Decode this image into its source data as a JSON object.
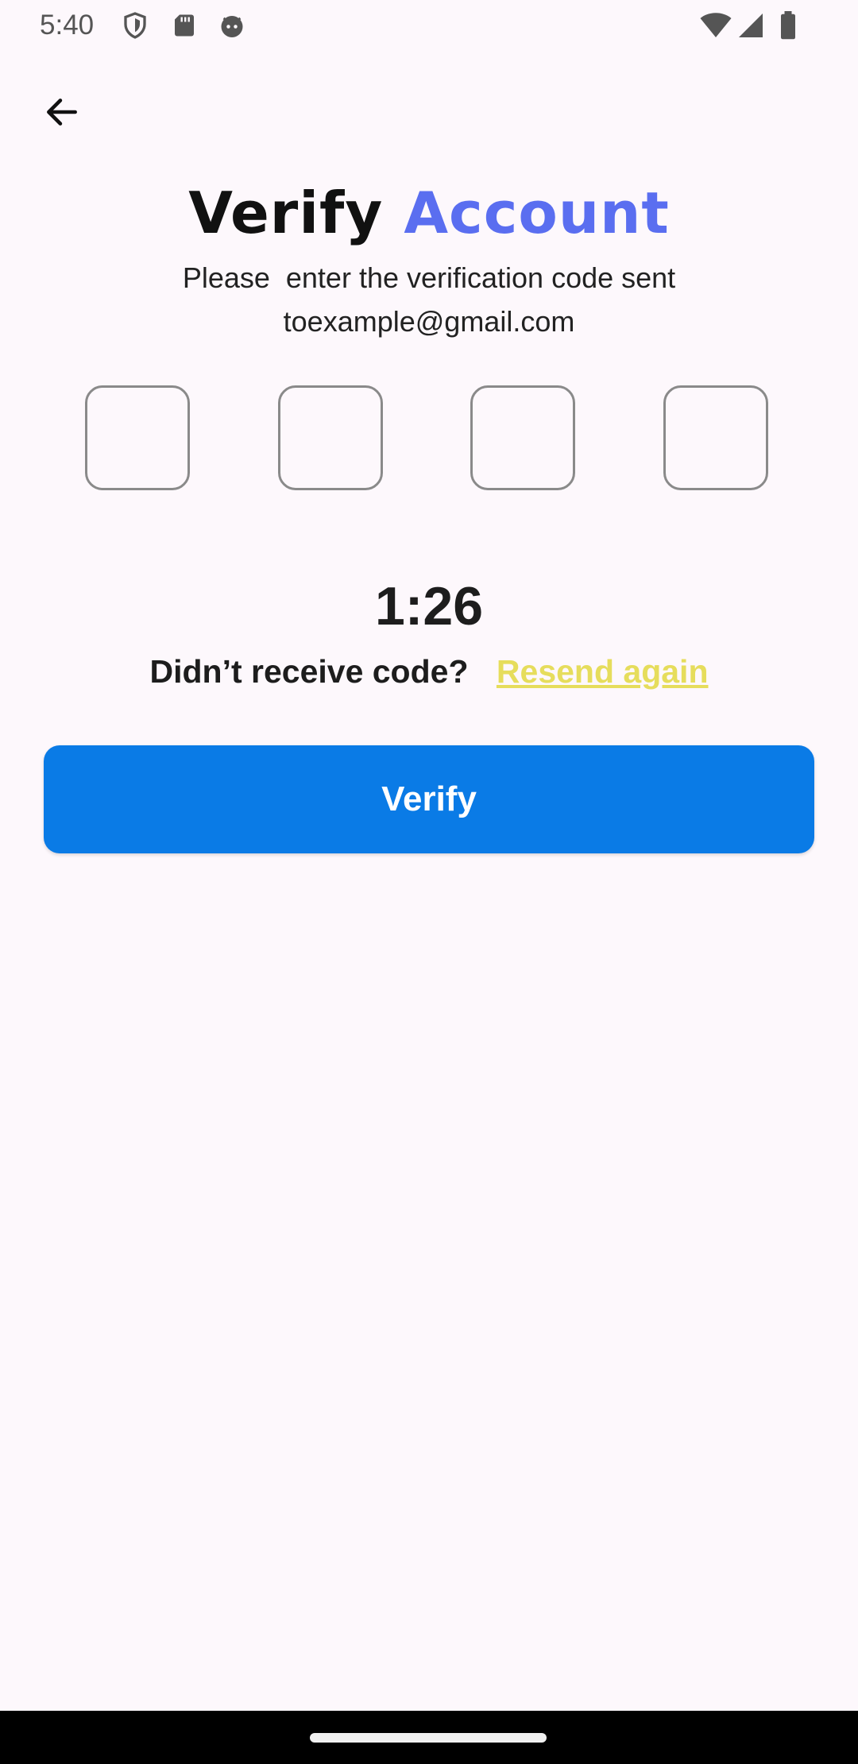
{
  "status_bar": {
    "time": "5:40",
    "icons": [
      "shield-icon",
      "sd-card-icon",
      "android-face-icon",
      "wifi-icon",
      "signal-icon",
      "battery-icon"
    ]
  },
  "header": {
    "back_icon": "arrow-left-icon"
  },
  "title": {
    "part1": "Verify",
    "part2": "Account",
    "accent_color": "#5a6ef0"
  },
  "subtitle": {
    "line1": "Please  enter the verification code sent",
    "line2": "toexample@gmail.com"
  },
  "code_inputs": [
    {
      "value": ""
    },
    {
      "value": ""
    },
    {
      "value": ""
    },
    {
      "value": ""
    }
  ],
  "timer": "1:26",
  "resend": {
    "prompt": "Didn’t receive code?",
    "link": "Resend again",
    "link_color": "#e6dd5c"
  },
  "verify_button": {
    "label": "Verify",
    "color": "#0a7be6"
  }
}
